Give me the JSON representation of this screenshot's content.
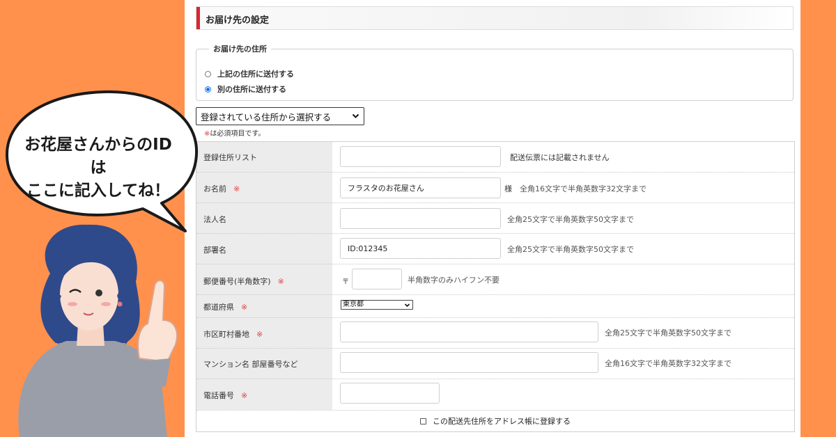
{
  "section": {
    "title": "お届け先の設定"
  },
  "address_group": {
    "legend": "お届け先の住所",
    "options": [
      {
        "label": "上記の住所に送付する",
        "checked": false
      },
      {
        "label": "別の住所に送付する",
        "checked": true
      }
    ]
  },
  "registered_select": {
    "value": "登録されている住所から選択する"
  },
  "required_note": {
    "mark": "※",
    "text": "は必須項目です。"
  },
  "form": {
    "address_list": {
      "label": "登録住所リスト",
      "value": "",
      "hint": "配送伝票には記載されません"
    },
    "name": {
      "label": "お名前",
      "req": "※",
      "value": "フラスタのお花屋さん",
      "suffix": "様",
      "hint": "全角16文字で半角英数字32文字まで"
    },
    "company": {
      "label": "法人名",
      "value": "",
      "hint": "全角25文字で半角英数字50文字まで"
    },
    "department": {
      "label": "部署名",
      "value": "ID:012345",
      "hint": "全角25文字で半角英数字50文字まで"
    },
    "postal": {
      "label": "郵便番号(半角数字)",
      "req": "※",
      "mark": "〒",
      "value": "",
      "hint": "半角数字のみハイフン不要"
    },
    "prefecture": {
      "label": "都道府県",
      "req": "※",
      "value": "東京都"
    },
    "city": {
      "label": "市区町村番地",
      "req": "※",
      "value": "",
      "hint": "全角25文字で半角英数字50文字まで"
    },
    "building": {
      "label": "マンション名 部屋番号など",
      "value": "",
      "hint": "全角16文字で半角英数字32文字まで"
    },
    "phone": {
      "label": "電話番号",
      "req": "※",
      "value": ""
    }
  },
  "save_address": {
    "label": "この配送先住所をアドレス帳に登録する",
    "checked": false
  },
  "speech_bubble": {
    "line1": "お花屋さんからのIDは",
    "line2": "ここに記入してね！"
  },
  "colors": {
    "background": "#ff914d",
    "accent_red": "#d7282f",
    "required": "#e43b3b",
    "radio_checked": "#1a73e8"
  }
}
